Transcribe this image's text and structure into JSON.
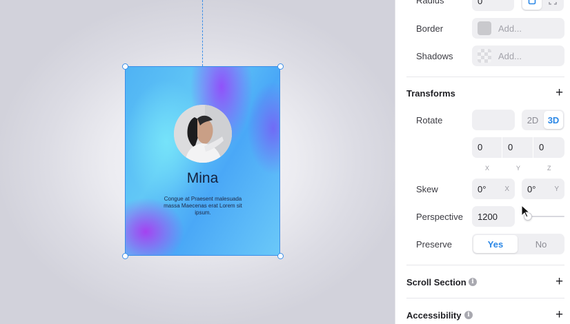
{
  "card": {
    "name": "Mina",
    "description": "Congue at Praesent malesuada massa Maecenas erat Lorem sit ipsum."
  },
  "panel": {
    "radius": {
      "label": "Radius",
      "value": "0"
    },
    "border": {
      "label": "Border",
      "placeholder": "Add..."
    },
    "shadows": {
      "label": "Shadows",
      "placeholder": "Add..."
    },
    "transforms": {
      "title": "Transforms",
      "rotate": {
        "label": "Rotate",
        "value": "",
        "mode_2d": "2D",
        "mode_3d": "3D",
        "selected_mode": "3D"
      },
      "xyz": {
        "x": "0",
        "y": "0",
        "z": "0",
        "x_label": "X",
        "y_label": "Y",
        "z_label": "Z"
      },
      "skew": {
        "label": "Skew",
        "x_value": "0°",
        "x_suffix": "X",
        "y_value": "0°",
        "y_suffix": "Y"
      },
      "perspective": {
        "label": "Perspective",
        "value": "1200",
        "slider_fraction": 0.0
      },
      "preserve": {
        "label": "Preserve",
        "yes": "Yes",
        "no": "No",
        "selected": "Yes"
      }
    },
    "scroll_section": {
      "title": "Scroll Section"
    },
    "accessibility": {
      "title": "Accessibility"
    }
  },
  "icons": {
    "plus": "+",
    "info": "i"
  },
  "colors": {
    "accent": "#2a87e6",
    "selection": "#3a8ee8",
    "border_swatch": "#c9c9cd"
  }
}
